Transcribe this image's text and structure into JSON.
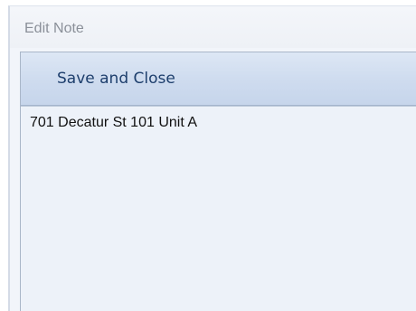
{
  "window": {
    "title": "Edit Note"
  },
  "toolbar": {
    "save_close_label": "Save and Close"
  },
  "note": {
    "text": "701 Decatur St 101 Unit A"
  },
  "colors": {
    "title_text": "#8b9099",
    "toolbar_top": "#dde7f5",
    "toolbar_bottom": "#c6d5eb",
    "button_text": "#1e3f6d",
    "editor_background": "#edf2f9"
  }
}
